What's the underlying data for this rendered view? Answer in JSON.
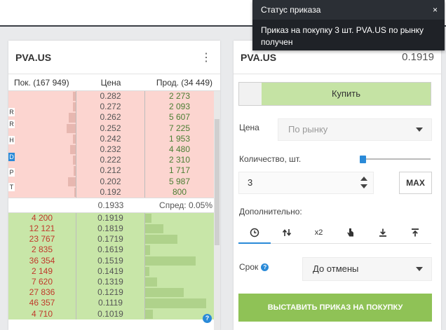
{
  "toast": {
    "title": "Статус приказа",
    "close": "×",
    "message": "Приказ на покупку 3 шт. PVA.US по рынку получен"
  },
  "book": {
    "title": "PVA.US",
    "menu_icon": "⋮",
    "headers": {
      "bids": "Пок. (167 949)",
      "price": "Цена",
      "asks": "Прод. (34 449)"
    },
    "side_keys": [
      "R",
      "R",
      "H",
      "D",
      "P",
      "T"
    ],
    "active_side_key": 3,
    "asks": [
      {
        "price": "0.282",
        "qty": "2 273",
        "depth": 0.3
      },
      {
        "price": "0.272",
        "qty": "2 093",
        "depth": 0.28
      },
      {
        "price": "0.262",
        "qty": "5 607",
        "depth": 0.72
      },
      {
        "price": "0.252",
        "qty": "7 225",
        "depth": 0.9
      },
      {
        "price": "0.242",
        "qty": "1 953",
        "depth": 0.26
      },
      {
        "price": "0.232",
        "qty": "4 480",
        "depth": 0.58
      },
      {
        "price": "0.222",
        "qty": "2 310",
        "depth": 0.3
      },
      {
        "price": "0.212",
        "qty": "1 717",
        "depth": 0.23
      },
      {
        "price": "0.202",
        "qty": "5 987",
        "depth": 0.76
      },
      {
        "price": "0.192",
        "qty": "800",
        "depth": 0.12
      }
    ],
    "spread": {
      "mid": "0.1933",
      "label": "Спред: 0.05%"
    },
    "bids": [
      {
        "qty": "4 200",
        "price": "0.1919",
        "depth": 0.1
      },
      {
        "qty": "12 121",
        "price": "0.1819",
        "depth": 0.28
      },
      {
        "qty": "23 767",
        "price": "0.1719",
        "depth": 0.5
      },
      {
        "qty": "2 835",
        "price": "0.1619",
        "depth": 0.08
      },
      {
        "qty": "36 354",
        "price": "0.1519",
        "depth": 0.78
      },
      {
        "qty": "2 149",
        "price": "0.1419",
        "depth": 0.06
      },
      {
        "qty": "7 620",
        "price": "0.1319",
        "depth": 0.18
      },
      {
        "qty": "27 836",
        "price": "0.1219",
        "depth": 0.6
      },
      {
        "qty": "46 357",
        "price": "0.1119",
        "depth": 0.95
      },
      {
        "qty": "4 710",
        "price": "0.1019",
        "depth": 0.12
      }
    ],
    "help": "?"
  },
  "order": {
    "symbol": "PVA.US",
    "last_price": "0.1919",
    "buy_label": "Купить",
    "price_label": "Цена",
    "price_value": "По рынку",
    "qty_label": "Количество, шт.",
    "qty_value": "3",
    "max_label": "MAX",
    "extra_label": "Дополнительно:",
    "order_types": [
      {
        "icon": "clock-icon"
      },
      {
        "icon": "arrows-icon"
      },
      {
        "icon": "x2-icon",
        "text": "x2"
      },
      {
        "icon": "hand-pointer-icon"
      },
      {
        "icon": "download-icon"
      },
      {
        "icon": "upload-icon"
      }
    ],
    "term_label": "Срок",
    "term_value": "До отмены",
    "submit_label": "ВЫСТАВИТЬ ПРИКАЗ НА ПОКУПКУ",
    "help": "?"
  },
  "colors": {
    "ask_bg": "#fcd5d0",
    "bid_bg": "#c8e6a8",
    "accent": "#2a8ad8",
    "submit": "#8fc256"
  }
}
